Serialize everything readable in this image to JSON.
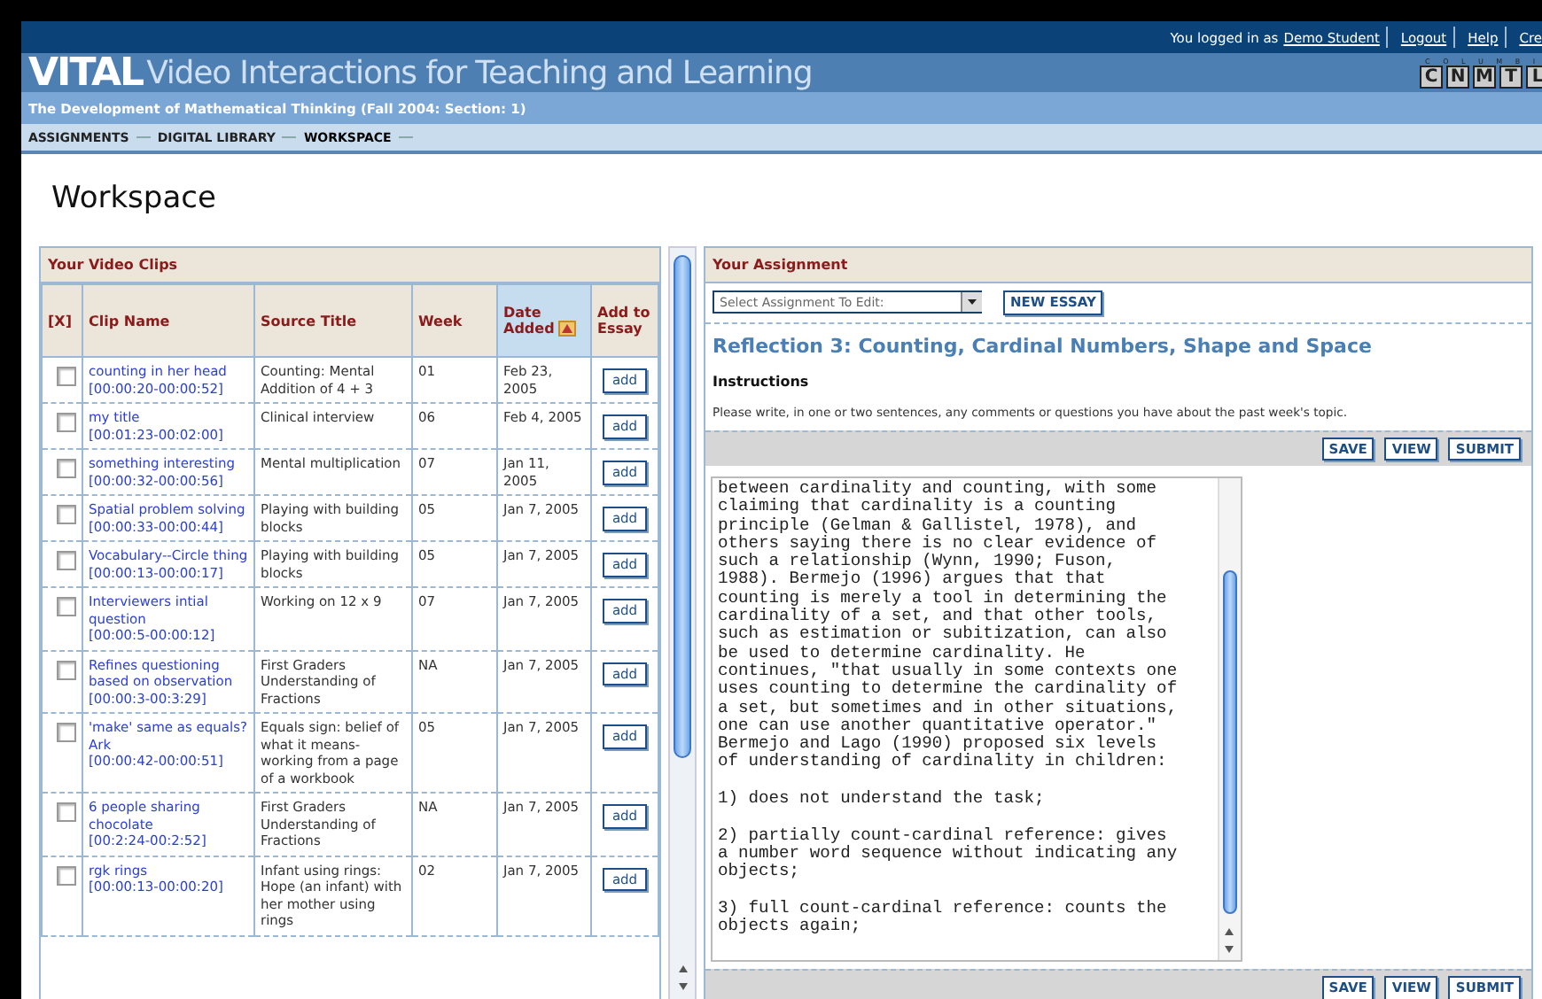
{
  "top_bar": {
    "logged_in_text": "You logged in as",
    "user_link": "Demo Student",
    "links": [
      "Logout",
      "Help",
      "Cre"
    ]
  },
  "brand": {
    "name": "VITAL",
    "subtitle": "Video Interactions for Teaching and Learning",
    "logo_small": "C O L U M B I",
    "logo_letters": [
      "C",
      "N",
      "M",
      "T",
      "L"
    ]
  },
  "course_title": "The Development of Mathematical Thinking (Fall 2004: Section: 1)",
  "nav": [
    {
      "label": "ASSIGNMENTS",
      "selected": false
    },
    {
      "label": "DIGITAL LIBRARY",
      "selected": false
    },
    {
      "label": "WORKSPACE",
      "selected": true
    }
  ],
  "page_title": "Workspace",
  "clips": {
    "title": "Your Video Clips",
    "columns": [
      {
        "label": "[X]",
        "sorted": false
      },
      {
        "label": "Clip Name",
        "sorted": false
      },
      {
        "label": "Source Title",
        "sorted": false
      },
      {
        "label": "Week",
        "sorted": false
      },
      {
        "label": "Date Added",
        "sorted": true
      },
      {
        "label": "Add to Essay",
        "sorted": false
      }
    ],
    "rows": [
      {
        "checked": false,
        "name": "counting in her head",
        "range": "[00:00:20-00:00:52]",
        "source": "Counting: Mental Addition of 4 + 3",
        "week": "01",
        "date": "Feb 23, 2005",
        "button": "add"
      },
      {
        "checked": false,
        "name": "my title",
        "range": "[00:01:23-00:02:00]",
        "source": "Clinical interview",
        "week": "06",
        "date": "Feb 4, 2005",
        "button": "add"
      },
      {
        "checked": false,
        "name": "something interesting",
        "range": "[00:00:32-00:00:56]",
        "source": "Mental multiplication",
        "week": "07",
        "date": "Jan 11, 2005",
        "button": "add"
      },
      {
        "checked": false,
        "name": "Spatial problem solving",
        "range": "[00:00:33-00:00:44]",
        "source": "Playing with building blocks",
        "week": "05",
        "date": "Jan 7, 2005",
        "button": "add"
      },
      {
        "checked": false,
        "name": "Vocabulary--Circle thing",
        "range": "[00:00:13-00:00:17]",
        "source": "Playing with building blocks",
        "week": "05",
        "date": "Jan 7, 2005",
        "button": "add"
      },
      {
        "checked": false,
        "name": "Interviewers intial question",
        "range": "[00:00:5-00:00:12]",
        "source": "Working on 12 x 9",
        "week": "07",
        "date": "Jan 7, 2005",
        "button": "add"
      },
      {
        "checked": false,
        "name": "Refines questioning based on observation",
        "range": "[00:00:3-00:3:29]",
        "source": "First Graders Understanding of Fractions",
        "week": "NA",
        "date": "Jan 7, 2005",
        "button": "add"
      },
      {
        "checked": false,
        "name": "'make' same as equals? Ark",
        "range": "[00:00:42-00:00:51]",
        "source": "Equals sign: belief of what it means- working from a page of a workbook",
        "week": "05",
        "date": "Jan 7, 2005",
        "button": "add"
      },
      {
        "checked": false,
        "name": "6 people sharing chocolate",
        "range": "[00:2:24-00:2:52]",
        "source": "First Graders Understanding of Fractions",
        "week": "NA",
        "date": "Jan 7, 2005",
        "button": "add"
      },
      {
        "checked": false,
        "name": "rgk rings",
        "range": "[00:00:13-00:00:20]",
        "source": "Infant using rings: Hope (an infant) with her mother using rings",
        "week": "02",
        "date": "Jan 7, 2005",
        "button": "add"
      }
    ]
  },
  "assignment": {
    "title": "Your Assignment",
    "select": {
      "placeholder": "Select Assignment To Edit:"
    },
    "new_button": "NEW ESSAY",
    "heading": "Reflection 3: Counting, Cardinal Numbers, Shape and Space",
    "instructions_label": "Instructions",
    "instructions": "Please write, in one or two sentences, any comments or questions you have about the past week's topic.",
    "top_buttons": [
      "SAVE",
      "VIEW",
      "SUBMIT"
    ],
    "essay": "between cardinality and counting, with some\nclaiming that cardinality is a counting\nprinciple (Gelman & Gallistel, 1978), and\nothers saying there is no clear evidence of\nsuch a relationship (Wynn, 1990; Fuson,\n1988). Bermejo (1996) argues that that\ncounting is merely a tool in determining the\ncardinality of a set, and that other tools,\nsuch as estimation or subitization, can also\nbe used to determine cardinality. He\ncontinues, \"that usually in some contexts one\nuses counting to determine the cardinality of\na set, but sometimes and in other situations,\none can use another quantitative operator.\"\nBermejo and Lago (1990) proposed six levels\nof understanding of cardinality in children:\n\n1) does not understand the task;\n\n2) partially count-cardinal reference: gives\na number word sequence without indicating any\nobjects;\n\n3) full count-cardinal reference: counts the\nobjects again;",
    "bottom_buttons": [
      "SAVE",
      "VIEW",
      "SUBMIT"
    ]
  }
}
